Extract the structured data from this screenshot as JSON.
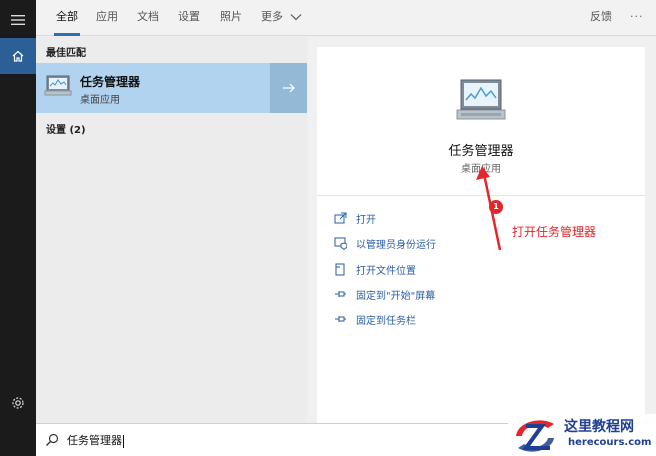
{
  "tabs": [
    {
      "label": "全部",
      "active": true
    },
    {
      "label": "应用"
    },
    {
      "label": "文档"
    },
    {
      "label": "设置"
    },
    {
      "label": "照片"
    },
    {
      "label": "更多"
    }
  ],
  "top_right": {
    "feedback": "反馈",
    "more_dots": "···"
  },
  "results": {
    "best_match_header": "最佳匹配",
    "best_match": {
      "title": "任务管理器",
      "subtitle": "桌面应用"
    },
    "settings_header": "设置 (2)"
  },
  "detail": {
    "title": "任务管理器",
    "subtitle": "桌面应用",
    "actions": [
      {
        "label": "打开",
        "icon": "open-window-icon"
      },
      {
        "label": "以管理员身份运行",
        "icon": "shield-run-icon"
      },
      {
        "label": "打开文件位置",
        "icon": "file-location-icon"
      },
      {
        "label": "固定到\"开始\"屏幕",
        "icon": "pin-icon"
      },
      {
        "label": "固定到任务栏",
        "icon": "pin-icon"
      }
    ]
  },
  "annotation": {
    "badge": "1",
    "text": "打开任务管理器",
    "color": "#e4262b"
  },
  "search": {
    "value": "任务管理器"
  },
  "watermark": {
    "title": "这里教程网",
    "url": "herecours.com"
  },
  "colors": {
    "accent": "#2b6fba",
    "selected_row": "#b1d3ef",
    "link": "#2a5ea6"
  }
}
